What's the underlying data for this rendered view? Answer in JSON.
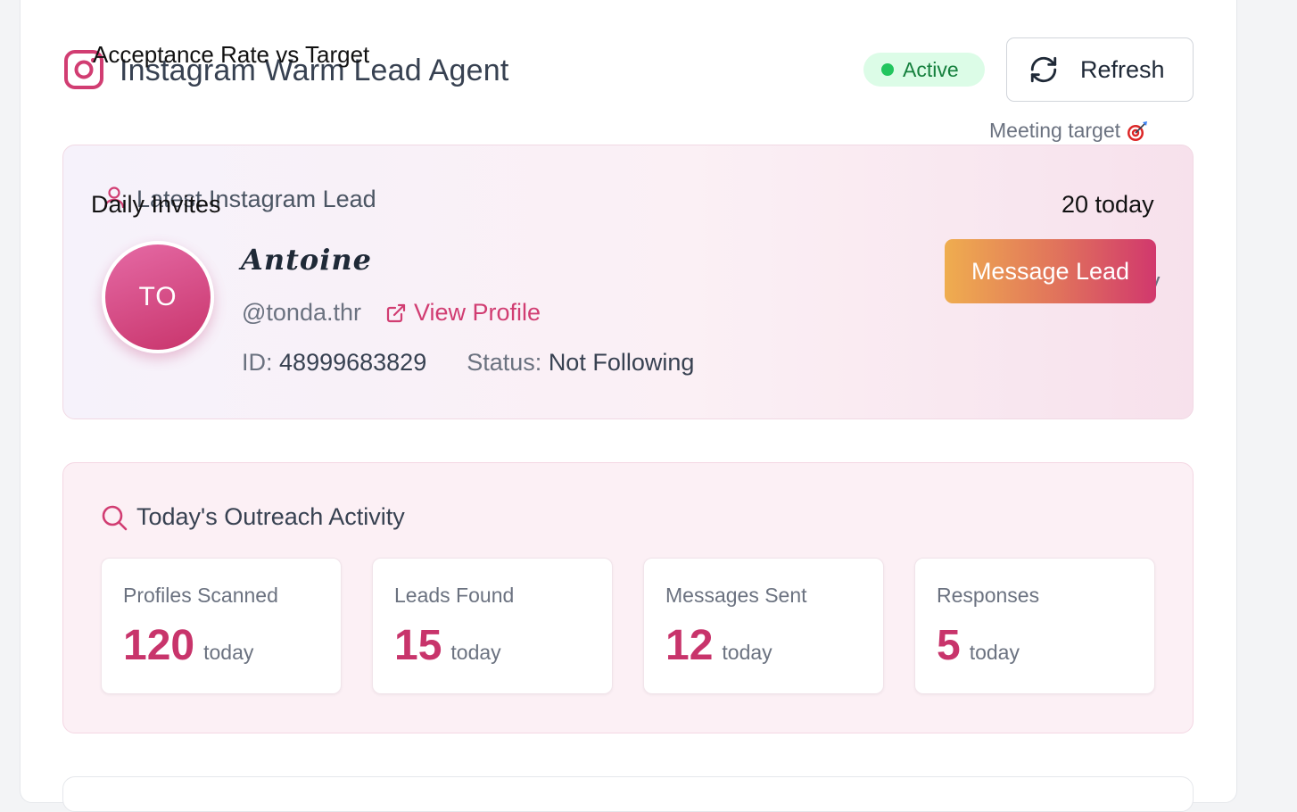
{
  "header": {
    "agent_title": "Instagram Warm Lead Agent",
    "overlay_chart_title": "Acceptance Rate vs Target",
    "status": "Active",
    "refresh_label": "Refresh",
    "meeting_target": "Meeting target"
  },
  "lead": {
    "heading": "Latest Instagram Lead",
    "overlay_daily": "Daily Invites",
    "overlay_today": "20 today",
    "initials": "TO",
    "name": "Antoine",
    "handle": "@tonda.thr",
    "view_profile": "View Profile",
    "id_label": "ID:",
    "id_value": "48999683829",
    "status_label": "Status:",
    "status_value": "Not Following",
    "partial_text": "y",
    "message_button": "Message Lead"
  },
  "outreach": {
    "heading": "Today's Outreach Activity",
    "stats": [
      {
        "label": "Profiles Scanned",
        "value": "120",
        "unit": "today"
      },
      {
        "label": "Leads Found",
        "value": "15",
        "unit": "today"
      },
      {
        "label": "Messages Sent",
        "value": "12",
        "unit": "today"
      },
      {
        "label": "Responses",
        "value": "5",
        "unit": "today"
      }
    ]
  },
  "icons": {
    "brand": "instagram-icon",
    "refresh": "refresh-icon",
    "target": "target-icon",
    "user": "user-icon",
    "external_link": "external-link-icon",
    "search": "search-icon"
  },
  "colors": {
    "accent": "#c8346b",
    "status_bg": "#dcfce7",
    "status_text": "#15803d"
  }
}
